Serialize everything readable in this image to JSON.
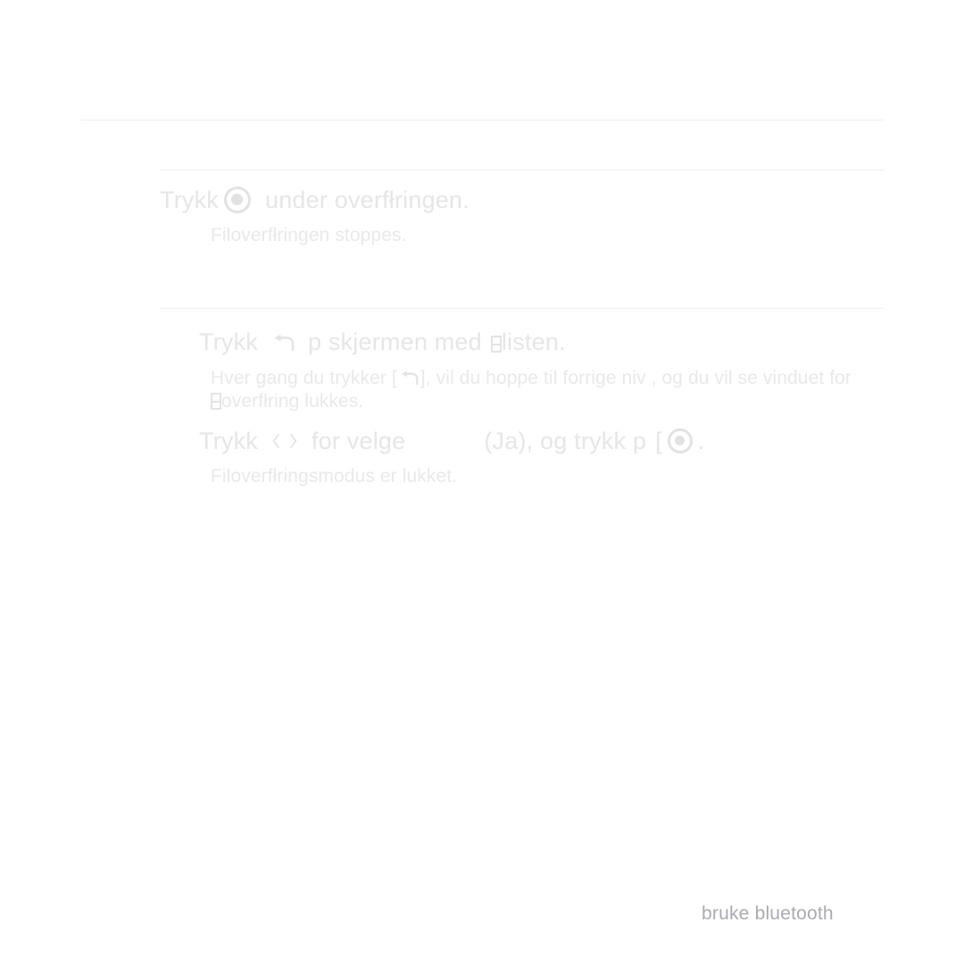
{
  "page": {
    "background_color": "#ffffff",
    "body_text_color": "#e6e6e9",
    "footer_text_color": "#a9abb1",
    "rule_color": "#f0f0f1",
    "language": "Norwegian"
  },
  "rules": [
    {
      "name": "top-rule"
    },
    {
      "name": "middle-rule"
    },
    {
      "name": "lower-rule"
    }
  ],
  "steps": [
    {
      "id": "step-stop-transfer",
      "heading": {
        "before_icon": "Trykk",
        "icon": "ok-button-icon",
        "after_icon": "under overfłringen."
      },
      "detail": "Filoverfłringen stoppes."
    },
    {
      "id": "step-back-screen",
      "heading": {
        "before_icon": "Trykk",
        "icon": "back-arrow-icon",
        "after_icon": "p  skjermen med",
        "box_glyph": "□",
        "tail": "listen."
      },
      "detail_line1_a": "Hver gang du trykker [",
      "detail_line1_icon": "back-arrow-icon",
      "detail_line1_b": "], vil du hoppe til forrige niv , og du vil se vinduet for",
      "detail_line2_box": "□",
      "detail_line2": "overfłring lukkes."
    },
    {
      "id": "step-select-yes",
      "heading": {
        "before_icon": "Trykk",
        "icon_left": "chevron-left-icon",
        "icon_right": "chevron-right-icon",
        "mid": "for  velge",
        "missing_label": "",
        "yes_label": "(Ja), og trykk p",
        "bracket": "[",
        "icon_ok": "ok-button-icon",
        "period": "."
      },
      "detail": "Filoverfłringsmodus er lukket."
    }
  ],
  "footer": {
    "text": "bruke bluetooth"
  }
}
